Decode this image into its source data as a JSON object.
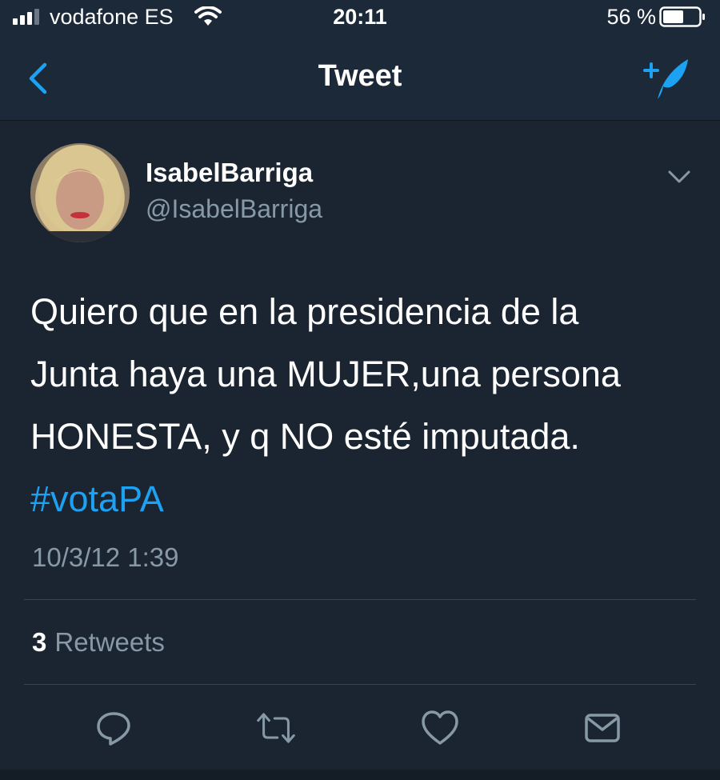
{
  "status_bar": {
    "carrier": "vodafone ES",
    "time": "20:11",
    "battery": "56 %",
    "signal_bars": 3,
    "battery_level": 0.56,
    "icons": [
      "signal-icon",
      "wifi-icon",
      "battery-icon"
    ]
  },
  "nav": {
    "title": "Tweet",
    "back_icon": "chevron-left-icon",
    "compose_icon": "compose-tweet-icon"
  },
  "tweet": {
    "display_name": "IsabelBarriga",
    "handle": "@IsabelBarriga",
    "text_lines": [
      "Quiero que en la presidencia de la",
      "Junta haya una MUJER,una persona",
      "HONESTA, y q NO esté imputada."
    ],
    "hashtag": "#votaPA",
    "timestamp": "10/3/12 1:39",
    "retweets_count": "3",
    "retweets_label": "Retweets"
  },
  "actions": [
    "reply-icon",
    "retweet-icon",
    "like-icon",
    "direct-message-icon"
  ],
  "colors": {
    "background": "#1b2532",
    "header": "#1c2938",
    "accent": "#1da1f2",
    "secondary_text": "#8899a6",
    "divider": "#38444d"
  }
}
